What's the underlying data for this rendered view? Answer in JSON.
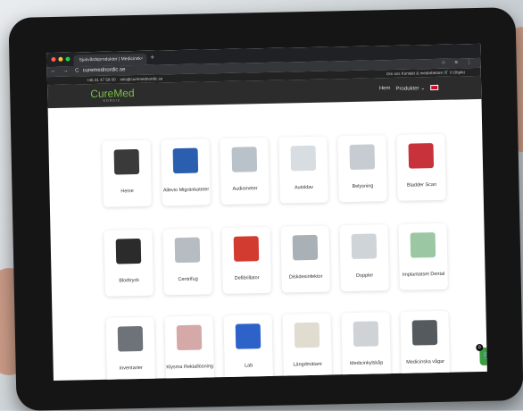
{
  "browser": {
    "tab_title": "Sjukvårdsprodukter | Medicinsk",
    "tab_close": "×",
    "new_tab": "+",
    "nav_buttons": "← → C",
    "url": "curemednordic.se",
    "tools": "☆ ≡ ⋮"
  },
  "topbar": {
    "phone": "+46 31 47 58 00",
    "email": "info@curemednordic.se",
    "links": "Om oss   Kontakt & medarbetare   🛒 0 Objekt"
  },
  "header": {
    "logo": "CureMed",
    "logo_sub": "NORDIC",
    "menu_home": "Hem",
    "menu_products": "Produkter ⌄"
  },
  "products": [
    {
      "label": "Heine",
      "color": "#3a3a3a"
    },
    {
      "label": "Allevio Migränkateter",
      "color": "#2a5fb0"
    },
    {
      "label": "Audiometer",
      "color": "#b9c2c9"
    },
    {
      "label": "Autoklav",
      "color": "#d8dde1"
    },
    {
      "label": "Belysning",
      "color": "#c6ccd1"
    },
    {
      "label": "Bladder Scan",
      "color": "#c8323a"
    },
    {
      "label": "Blodtryck",
      "color": "#2b2b2b"
    },
    {
      "label": "Centrifug",
      "color": "#b7bcc2"
    },
    {
      "label": "Defibrillator",
      "color": "#d23b2f"
    },
    {
      "label": "Diskdesinfektor",
      "color": "#a9b0b6"
    },
    {
      "label": "Doppler",
      "color": "#cfd4d8"
    },
    {
      "label": "Implantatset Dental",
      "color": "#9bc7a3"
    },
    {
      "label": "Inventarier",
      "color": "#6d7378"
    },
    {
      "label": "Klysma Rektallösning",
      "color": "#d6a9a9"
    },
    {
      "label": "Lab",
      "color": "#2d63c8"
    },
    {
      "label": "Längdmätare",
      "color": "#e0dccf"
    },
    {
      "label": "Medicinkylskåp",
      "color": "#cfd3d6"
    },
    {
      "label": "Medicinska vågar",
      "color": "#555a5e"
    }
  ],
  "cart": {
    "count": "0"
  }
}
